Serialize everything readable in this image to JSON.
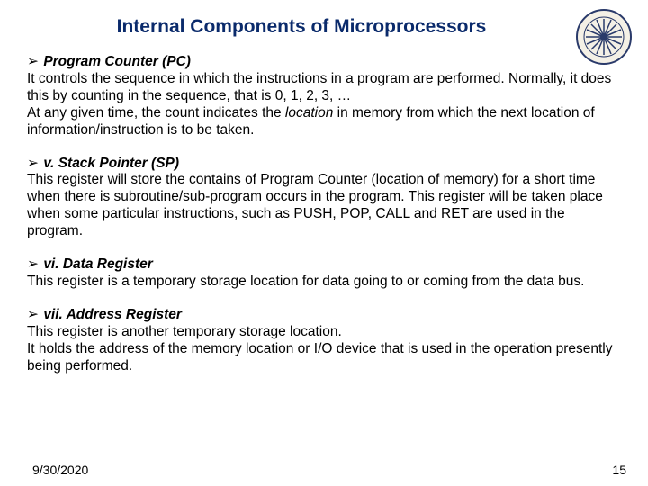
{
  "title": "Internal Components of Microprocessors",
  "sections": [
    {
      "heading": "Program Counter (PC)",
      "body_parts": [
        "It controls the sequence in which the instructions in a program are performed. Normally, it does this by counting in the sequence, that is 0, 1, 2, 3, …",
        "At any given time, the count indicates the ",
        "location",
        " in memory from which the next location of information/instruction is to be taken."
      ]
    },
    {
      "heading": "v. Stack Pointer (SP)",
      "body": "This register will store the contains of Program Counter (location of memory) for a short time when there is subroutine/sub-program occurs in the program. This register will be taken place when some particular instructions, such as PUSH, POP, CALL and RET are used in the program."
    },
    {
      "heading": "vi. Data Register",
      "body": "This register is a temporary storage location for data going to or coming from the data bus."
    },
    {
      "heading": "vii. Address Register",
      "body": "This register is another temporary storage location.\nIt holds the address of the memory location or I/O device that is used in the operation presently being performed."
    }
  ],
  "footer": {
    "date": "9/30/2020",
    "page": "15"
  },
  "logo": {
    "name": "university-seal"
  }
}
